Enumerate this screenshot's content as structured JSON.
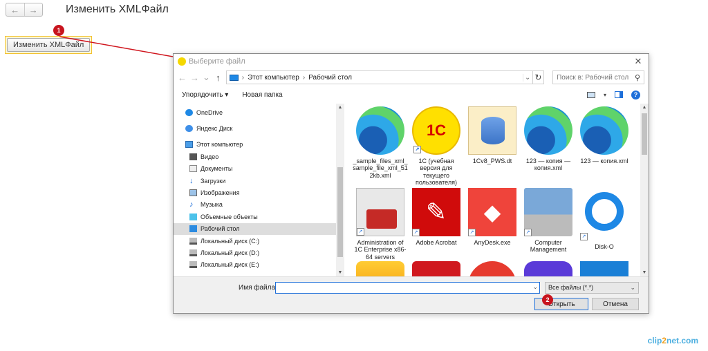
{
  "page": {
    "title": "Изменить XMLФайл",
    "change_button": "Изменить XMLФайл"
  },
  "nav": {
    "back": "←",
    "forward": "→"
  },
  "markers": [
    "1",
    "2"
  ],
  "dialog": {
    "title": "Выберите файл",
    "close": "✕",
    "address": {
      "part1": "Этот компьютер",
      "part2": "Рабочий стол",
      "sep": "›"
    },
    "search_placeholder": "Поиск в: Рабочий стол",
    "toolbar": {
      "organize": "Упорядочить ▾",
      "new_folder": "Новая папка"
    },
    "nav_pane": [
      {
        "label": "OneDrive"
      },
      {
        "label": "Яндекс Диск"
      },
      {
        "label": "Этот компьютер"
      },
      {
        "label": "Видео"
      },
      {
        "label": "Документы"
      },
      {
        "label": "Загрузки"
      },
      {
        "label": "Изображения"
      },
      {
        "label": "Музыка"
      },
      {
        "label": "Объемные объекты"
      },
      {
        "label": "Рабочий стол"
      },
      {
        "label": "Локальный диск (C:)"
      },
      {
        "label": "Локальный диск (D:)"
      },
      {
        "label": "Локальный диск (E:)"
      }
    ],
    "files": [
      {
        "label": "_sample_files_xml_sample_file_xml_512kb.xml"
      },
      {
        "label": "1C (учебная версия для текущего пользователя)"
      },
      {
        "label": "1Cv8_PWS.dt"
      },
      {
        "label": "123 — копия — копия.xml"
      },
      {
        "label": "123 — копия.xml"
      },
      {
        "label": "Administration of 1C Enterprise x86-64 servers"
      },
      {
        "label": "Adobe Acrobat"
      },
      {
        "label": "AnyDesk.exe"
      },
      {
        "label": "Computer Management"
      },
      {
        "label": "Disk-O"
      }
    ],
    "footer": {
      "filename_label": "Имя файла:",
      "filename_value": "",
      "filter": "Все файлы (*.*)",
      "open": "Открыть",
      "cancel": "Отмена"
    }
  },
  "watermark": {
    "part1": "clip",
    "part2": "2",
    "part3": "net.com"
  },
  "colors": {
    "marker": "#c8141e",
    "accent": "#1e6fd9",
    "highlight": "#f2c230"
  }
}
